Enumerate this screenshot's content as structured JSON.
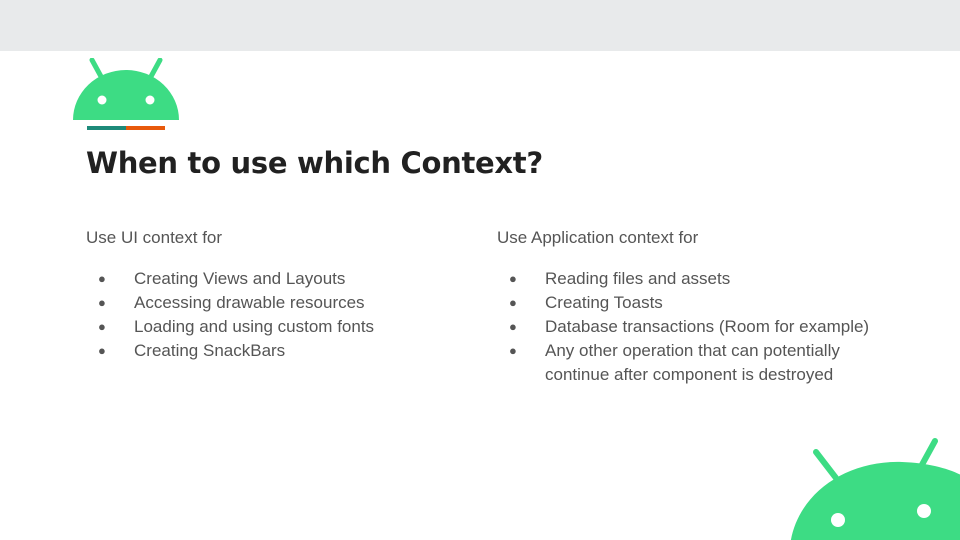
{
  "slide": {
    "title": "When to use which Context?",
    "colors": {
      "android_green": "#3ddc84",
      "accent_teal": "#1d8a7a",
      "accent_orange": "#e8590c",
      "title_text": "#212121",
      "body_text": "#555555",
      "top_bar": "#e8eaeb"
    },
    "icons": {
      "top_logo": "android-robot-head-icon",
      "bottom_logo": "android-robot-head-icon"
    },
    "left_column": {
      "heading": "Use UI context for",
      "items": [
        "Creating Views and Layouts",
        "Accessing drawable resources",
        "Loading and using custom fonts",
        "Creating SnackBars"
      ]
    },
    "right_column": {
      "heading": "Use Application context for",
      "items": [
        "Reading files and assets",
        "Creating Toasts",
        "Database transactions (Room for example)",
        "Any other operation that can potentially continue after component is destroyed"
      ]
    },
    "bullet_char": "●"
  }
}
